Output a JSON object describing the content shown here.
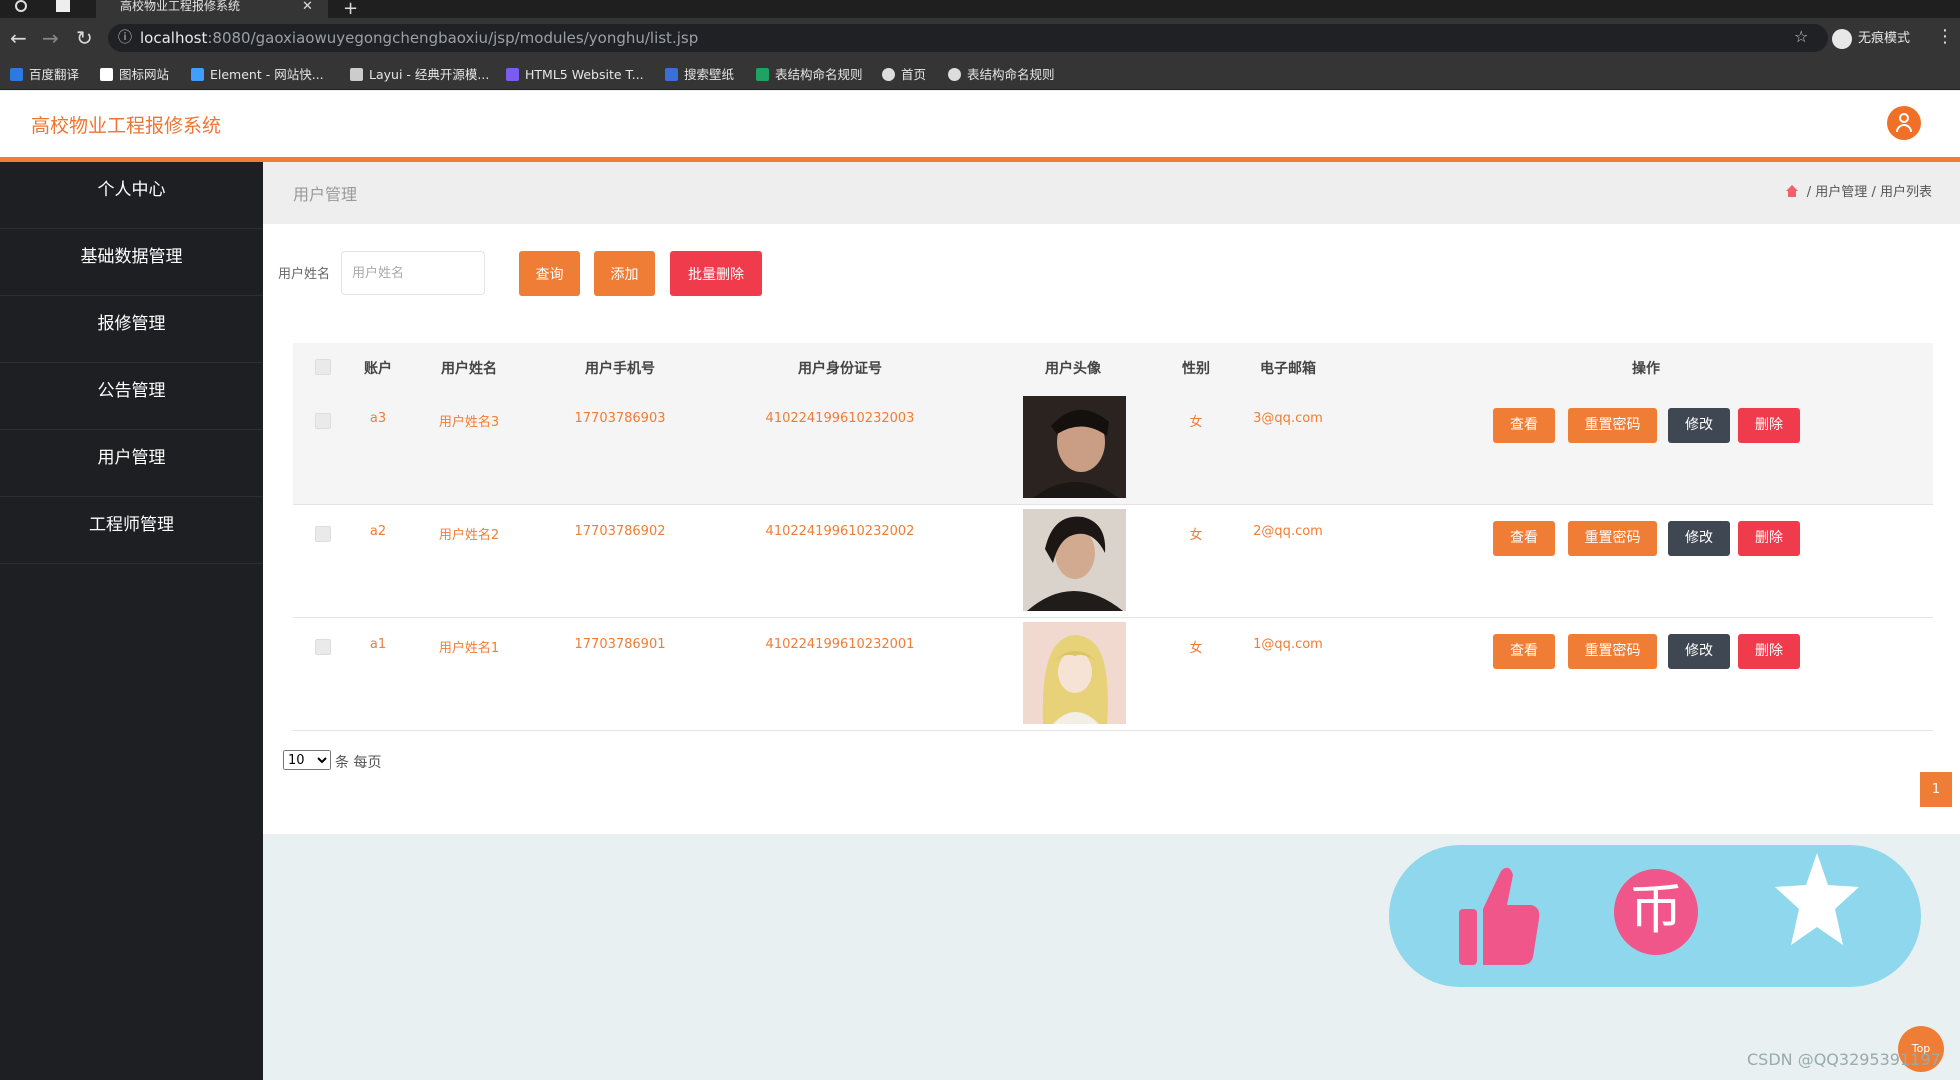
{
  "browser": {
    "tab_title": "高校物业工程报修系统",
    "url_host": "localhost",
    "url_rest": ":8080/gaoxiaowuyegongchengbaoxiu/jsp/modules/yonghu/list.jsp",
    "incognito_label": "无痕模式",
    "bookmarks": [
      "百度翻译",
      "图标网站",
      "Element - 网站快...",
      "Layui - 经典开源模...",
      "HTML5 Website T...",
      "搜索壁纸",
      "表结构命名规则",
      "首页",
      "表结构命名规则"
    ]
  },
  "app": {
    "title": "高校物业工程报修系统"
  },
  "sidebar": {
    "items": [
      "个人中心",
      "基础数据管理",
      "报修管理",
      "公告管理",
      "用户管理",
      "工程师管理"
    ]
  },
  "breadcrumb": {
    "title": "用户管理",
    "home": "",
    "path1": "用户管理",
    "path2": "用户列表",
    "sep": "/"
  },
  "search": {
    "label": "用户姓名",
    "placeholder": "用户姓名",
    "query_btn": "查询",
    "add_btn": "添加",
    "batch_delete_btn": "批量删除"
  },
  "table": {
    "columns": [
      "账户",
      "用户姓名",
      "用户手机号",
      "用户身份证号",
      "用户头像",
      "性别",
      "电子邮箱",
      "操作"
    ],
    "rows": [
      {
        "account": "a3",
        "name": "用户姓名3",
        "phone": "17703786903",
        "idcard": "410224199610232003",
        "gender": "女",
        "email": "3@qq.com"
      },
      {
        "account": "a2",
        "name": "用户姓名2",
        "phone": "17703786902",
        "idcard": "410224199610232002",
        "gender": "女",
        "email": "2@qq.com"
      },
      {
        "account": "a1",
        "name": "用户姓名1",
        "phone": "17703786901",
        "idcard": "410224199610232001",
        "gender": "女",
        "email": "1@qq.com"
      }
    ],
    "actions": {
      "view": "查看",
      "reset": "重置密码",
      "edit": "修改",
      "delete": "删除"
    }
  },
  "pagination": {
    "page_size": "10",
    "page_size_label": "条 每页",
    "current_page": "1"
  },
  "widget": {
    "top_label": "Top",
    "coin_glyph": "币"
  },
  "watermark": "CSDN @QQ3295391197",
  "colors": {
    "accent": "#f07d35",
    "danger": "#ef3b4b",
    "dark_button": "#3f4753",
    "sidebar": "#1e1f22"
  }
}
